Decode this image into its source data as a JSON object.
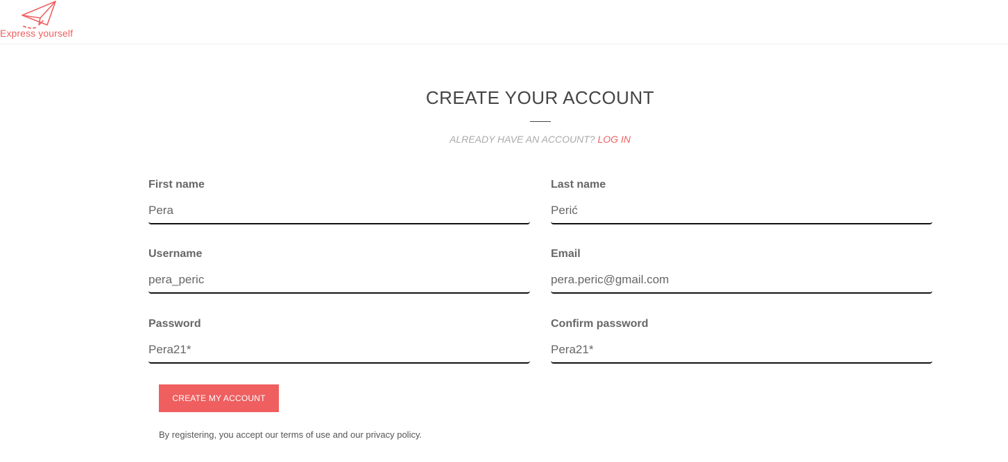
{
  "brand": {
    "logo_text": "Express yourself",
    "accent_color": "#ef5f60",
    "logo_icon": "paper-plane-icon"
  },
  "page": {
    "title": "CREATE YOUR ACCOUNT",
    "login_prompt": "ALREADY HAVE AN ACCOUNT?",
    "login_link": "LOG IN"
  },
  "form": {
    "first_name": {
      "label": "First name",
      "value": "Pera"
    },
    "last_name": {
      "label": "Last name",
      "value": "Perić"
    },
    "username": {
      "label": "Username",
      "value": "pera_peric"
    },
    "email": {
      "label": "Email",
      "value": "pera.peric@gmail.com"
    },
    "password": {
      "label": "Password",
      "value": "Pera21*"
    },
    "confirm_password": {
      "label": "Confirm password",
      "value": "Pera21*"
    },
    "submit_label": "CREATE MY ACCOUNT",
    "terms_text": "By registering, you accept our terms of use and our privacy policy."
  }
}
